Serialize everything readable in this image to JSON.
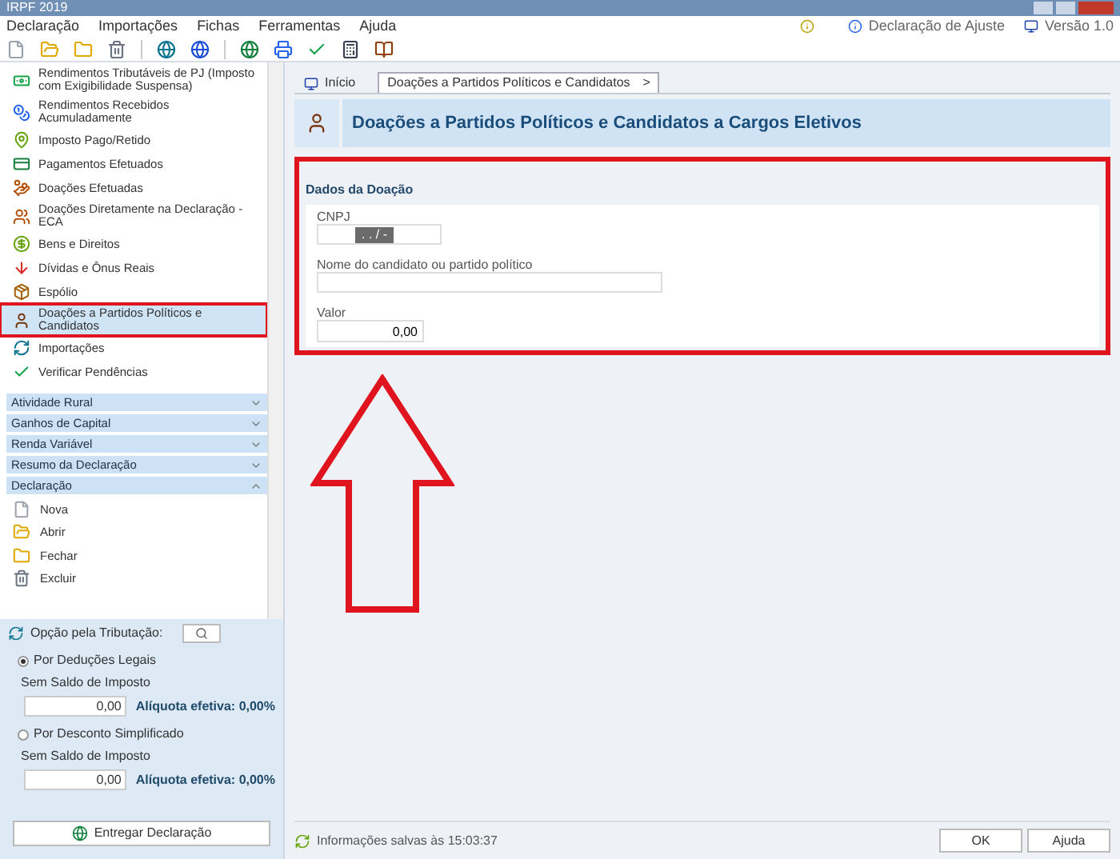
{
  "window": {
    "title": "IRPF 2019"
  },
  "menu": [
    "Declaração",
    "Importações",
    "Fichas",
    "Ferramentas",
    "Ajuda"
  ],
  "header_links": [
    {
      "kind": "help",
      "label": "Declaração de Ajuste"
    },
    {
      "kind": "version",
      "label": "Versão 1.0"
    }
  ],
  "sidebar": {
    "items": [
      {
        "label": "Rendimentos Tributáveis de PJ (Imposto com Exigibilidade Suspensa)",
        "selected": false
      },
      {
        "label": "Rendimentos Recebidos Acumuladamente",
        "selected": false
      },
      {
        "label": "Imposto Pago/Retido",
        "selected": false
      },
      {
        "label": "Pagamentos Efetuados",
        "selected": false
      },
      {
        "label": "Doações Efetuadas",
        "selected": false
      },
      {
        "label": "Doações Diretamente na Declaração - ECA",
        "selected": false
      },
      {
        "label": "Bens e Direitos",
        "selected": false
      },
      {
        "label": "Dívidas e Ônus Reais",
        "selected": false
      },
      {
        "label": "Espólio",
        "selected": false
      },
      {
        "label": "Doações a Partidos Políticos e Candidatos",
        "selected": true
      },
      {
        "label": "Importações",
        "selected": false
      },
      {
        "label": "Verificar Pendências",
        "selected": false
      }
    ],
    "sections": [
      {
        "label": "Atividade Rural",
        "expanded": false
      },
      {
        "label": "Ganhos de Capital",
        "expanded": false
      },
      {
        "label": "Renda Variável",
        "expanded": false
      },
      {
        "label": "Resumo da Declaração",
        "expanded": false
      },
      {
        "label": "Declaração",
        "expanded": true
      }
    ],
    "declaration_items": [
      "Nova",
      "Abrir",
      "Fechar",
      "Excluir"
    ]
  },
  "tax_option": {
    "title": "Opção pela Tributação:",
    "options": [
      {
        "label": "Por Deduções Legais",
        "selected": true,
        "status": "Sem Saldo de Imposto",
        "value": "0,00",
        "rate": "Alíquota efetiva: 0,00%"
      },
      {
        "label": "Por Desconto Simplificado",
        "selected": false,
        "status": "Sem Saldo de Imposto",
        "value": "0,00",
        "rate": "Alíquota efetiva: 0,00%"
      }
    ],
    "submit": "Entregar Declaração"
  },
  "tabs": [
    {
      "label": "Início",
      "selected": false,
      "closable": false
    },
    {
      "label": "Doações a Partidos Políticos e Candidatos",
      "selected": true,
      "closable": true,
      "close_glyph": ">"
    }
  ],
  "banner": {
    "title": "Doações a Partidos Políticos e Candidatos a Cargos Eletivos"
  },
  "form": {
    "section": "Dados da Doação",
    "fields": [
      {
        "kind": "masked",
        "label": "CNPJ",
        "placeholder": ". . / -"
      },
      {
        "kind": "text",
        "label": "Nome do candidato ou partido político"
      },
      {
        "kind": "number",
        "label": "Valor",
        "value": "0,00"
      }
    ]
  },
  "status": {
    "message": "Informações salvas às 15:03:37"
  },
  "buttons": [
    "OK",
    "Ajuda"
  ]
}
